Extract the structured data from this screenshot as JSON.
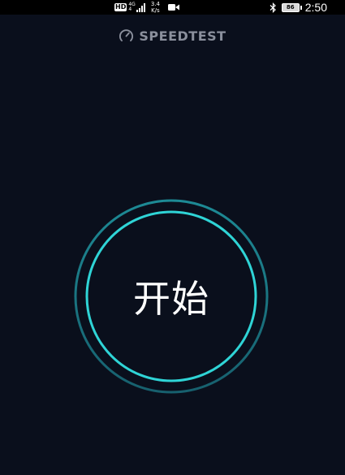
{
  "status_bar": {
    "hd_badge": "HD",
    "network_type_top": "4G",
    "network_type_bottom": "4",
    "speed_value": "3.4",
    "speed_unit": "K/s",
    "battery_level": "86",
    "clock": "2:50"
  },
  "header": {
    "title": "SPEEDTEST",
    "icon": "gauge-icon"
  },
  "main": {
    "go_button_label": "开始"
  },
  "colors": {
    "background": "#0a0f1c",
    "ring_inner": "#2fd4d6",
    "ring_outer": "#1b7e8c",
    "title_gray": "#8a8f9c"
  }
}
